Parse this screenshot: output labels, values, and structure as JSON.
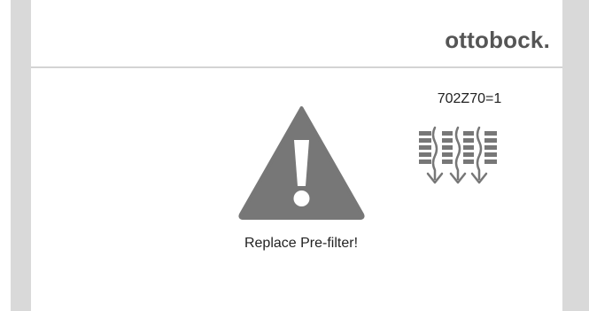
{
  "brand": {
    "logo_text": "ottobock."
  },
  "alert": {
    "icon": "warning-icon",
    "message": "Replace Pre-filter!"
  },
  "filter": {
    "part_number": "702Z70=1",
    "icon": "filter-flow-icon"
  },
  "colors": {
    "icon_gray": "#777777",
    "text": "#222222",
    "side_bar": "#d9d9d9",
    "logo": "#555555"
  }
}
